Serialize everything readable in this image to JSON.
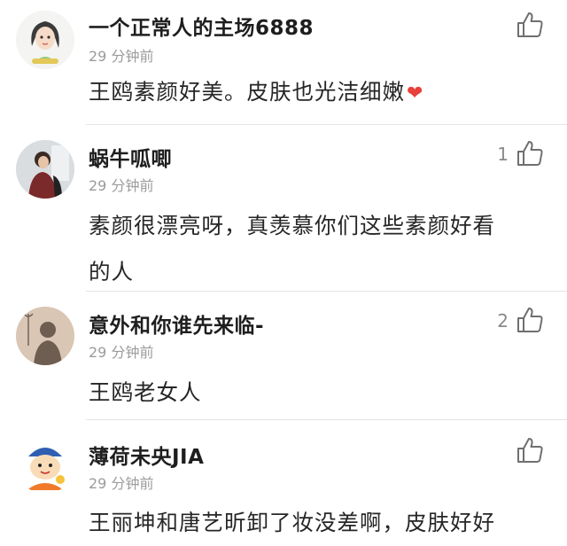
{
  "comments": [
    {
      "username": "一个正常人的主场6888",
      "time": "29 分钟前",
      "text_lines": [
        "王鸥素颜好美。皮肤也光洁细嫩"
      ],
      "emoji": "❤",
      "like_count": "",
      "avatar": "cartoon-girl-avatar"
    },
    {
      "username": "蜗牛呱唧",
      "time": "29 分钟前",
      "text_lines": [
        "素颜很漂亮呀，真羡慕你们这些素颜好看",
        "的人"
      ],
      "like_count": "1",
      "avatar": "photo-person-avatar"
    },
    {
      "username": "意外和你谁先来临-",
      "time": "29 分钟前",
      "text_lines": [
        "王鸥老女人"
      ],
      "like_count": "2",
      "avatar": "shadow-silhouette-avatar"
    },
    {
      "username": "薄荷未央JIA",
      "time": "29 分钟前",
      "text_lines": [
        "王丽坤和唐艺昕卸了妆没差啊，皮肤好好"
      ],
      "like_count": "",
      "avatar": "cartoon-child-avatar"
    }
  ],
  "icons": {
    "like": "thumbs-up-icon"
  },
  "colors": {
    "divider": "#e4e4e4",
    "time": "#9b9b9b",
    "heart": "#e8403a"
  }
}
